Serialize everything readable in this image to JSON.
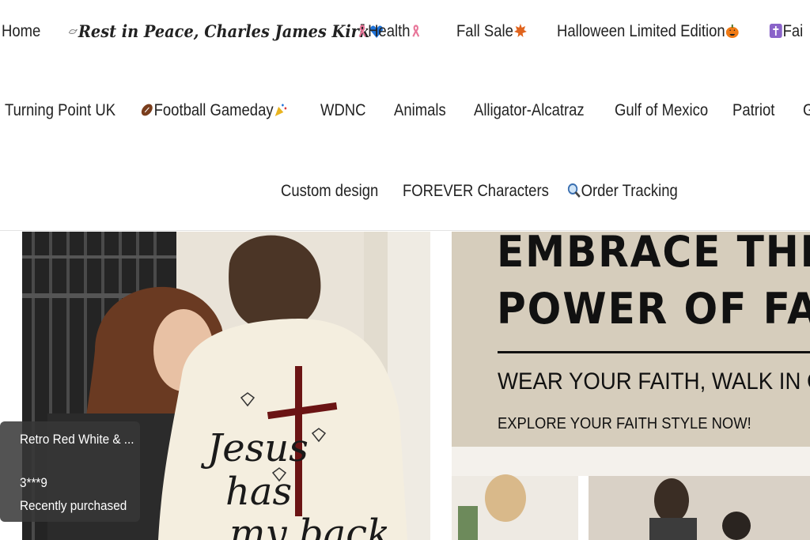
{
  "nav": {
    "row1": [
      {
        "label": "Home",
        "icon": ""
      },
      {
        "label": "Rest in Peace, Charles James Kirk",
        "icon_before": "dove-icon",
        "icon_after": "blue-heart-icon"
      },
      {
        "label": "Health",
        "icon_before": "pink-ribbon-icon",
        "icon_after": "pink-ribbon-icon"
      },
      {
        "label": "Fall Sale",
        "icon_after": "maple-leaf-icon"
      },
      {
        "label": "Halloween Limited Edition",
        "icon_after": "pumpkin-icon"
      },
      {
        "label": "Fai",
        "icon_before": "cross-icon"
      }
    ],
    "row2": [
      {
        "label": "Turning Point UK"
      },
      {
        "label": "Football Gameday",
        "icon_before": "football-icon",
        "icon_after": "party-popper-icon"
      },
      {
        "label": "WDNC"
      },
      {
        "label": "Animals"
      },
      {
        "label": "Alligator-Alcatraz"
      },
      {
        "label": "Gulf of Mexico"
      },
      {
        "label": "Patriot"
      },
      {
        "label": "G"
      }
    ],
    "row3": [
      {
        "label": "Custom design"
      },
      {
        "label": "FOREVER Characters"
      },
      {
        "label": "Order Tracking",
        "icon_before": "magnifier-icon"
      }
    ]
  },
  "banner_left": {
    "shirt_text": [
      "Jesus",
      "has",
      "my back"
    ]
  },
  "banner_right": {
    "headline_1": "EMBRACE THE",
    "headline_2": "POWER OF FAIT",
    "subline": "WEAR YOUR FAITH, WALK IN GR",
    "cta": "EXPLORE YOUR FAITH STYLE NOW!"
  },
  "popup": {
    "title": "Retro Red White & ...",
    "buyer": "3***9",
    "status": "Recently purchased"
  },
  "colors": {
    "text": "#222222",
    "banner_right_bg": "#d6cdbc",
    "popup_bg": "#373737",
    "shirt": "#f4eedf",
    "cross": "#6b1414",
    "heart": "#1e73d9",
    "ribbon": "#e8779a",
    "leaf": "#e0641e",
    "pumpkin": "#f07a14"
  }
}
